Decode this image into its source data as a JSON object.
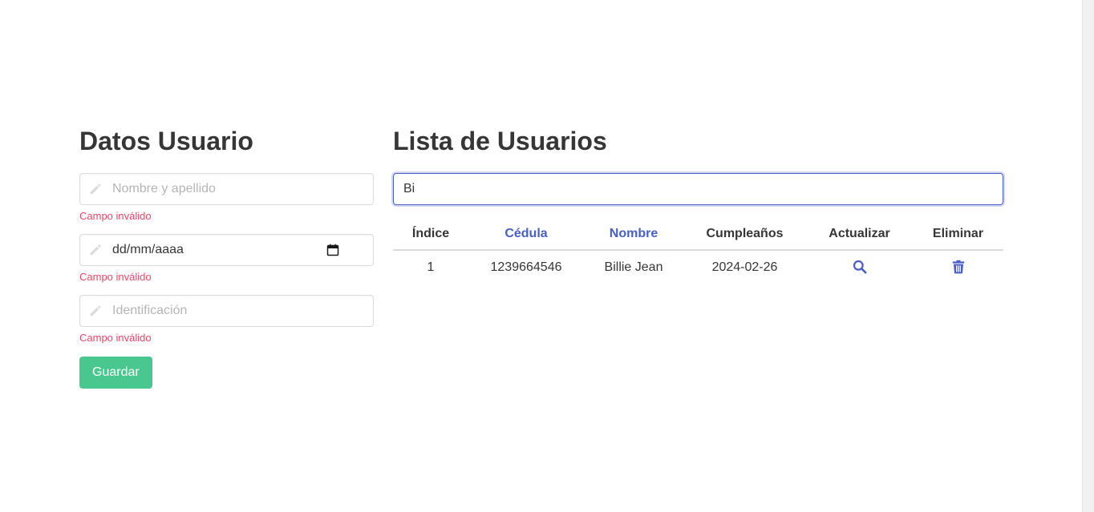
{
  "form": {
    "title": "Datos Usuario",
    "name_placeholder": "Nombre y apellido",
    "date_value": "dd/mm/aaaa",
    "id_placeholder": "Identificación",
    "error_text": "Campo inválido",
    "save_label": "Guardar"
  },
  "list": {
    "title": "Lista de Usuarios",
    "search_value": "Bi",
    "columns": [
      "Índice",
      "Cédula",
      "Nombre",
      "Cumpleaños",
      "Actualizar",
      "Eliminar"
    ],
    "rows": [
      {
        "index": "1",
        "cedula": "1239664546",
        "nombre": "Billie Jean",
        "cumple": "2024-02-26"
      }
    ]
  },
  "icons": {
    "field_icon": "pencil-icon",
    "date_picker_icon": "calendar-icon",
    "update_icon": "search-icon",
    "delete_icon": "trash-icon"
  },
  "colors": {
    "accent": "#485fc7",
    "success": "#48c78e",
    "danger": "#f14668",
    "text": "#363636",
    "placeholder": "#b5b5b5",
    "border": "#dbdbdb"
  }
}
